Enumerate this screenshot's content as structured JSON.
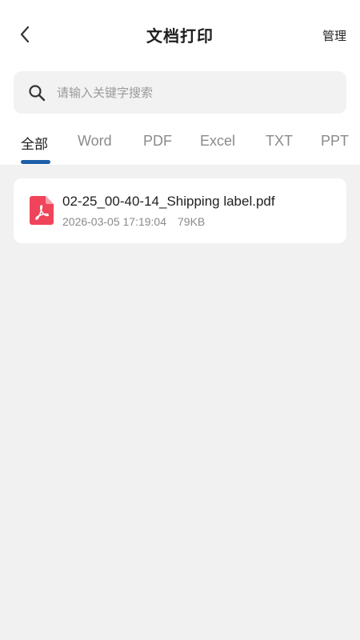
{
  "header": {
    "title": "文档打印",
    "manage_label": "管理",
    "back_icon": "chevron-left-icon"
  },
  "search": {
    "placeholder": "请输入关键字搜索",
    "value": "",
    "icon": "search-icon"
  },
  "tabs": [
    {
      "label": "全部",
      "active": true
    },
    {
      "label": "Word",
      "active": false
    },
    {
      "label": "PDF",
      "active": false
    },
    {
      "label": "Excel",
      "active": false
    },
    {
      "label": "TXT",
      "active": false
    },
    {
      "label": "PPT",
      "active": false
    }
  ],
  "files": [
    {
      "name": "02-25_00-40-14_Shipping label.pdf",
      "date": "2026-03-05 17:19:04",
      "size": "79KB",
      "icon": "pdf-file-icon"
    }
  ],
  "colors": {
    "accent": "#1d5fa8",
    "pdf_red": "#f0445a",
    "background": "#f1f1f1"
  }
}
